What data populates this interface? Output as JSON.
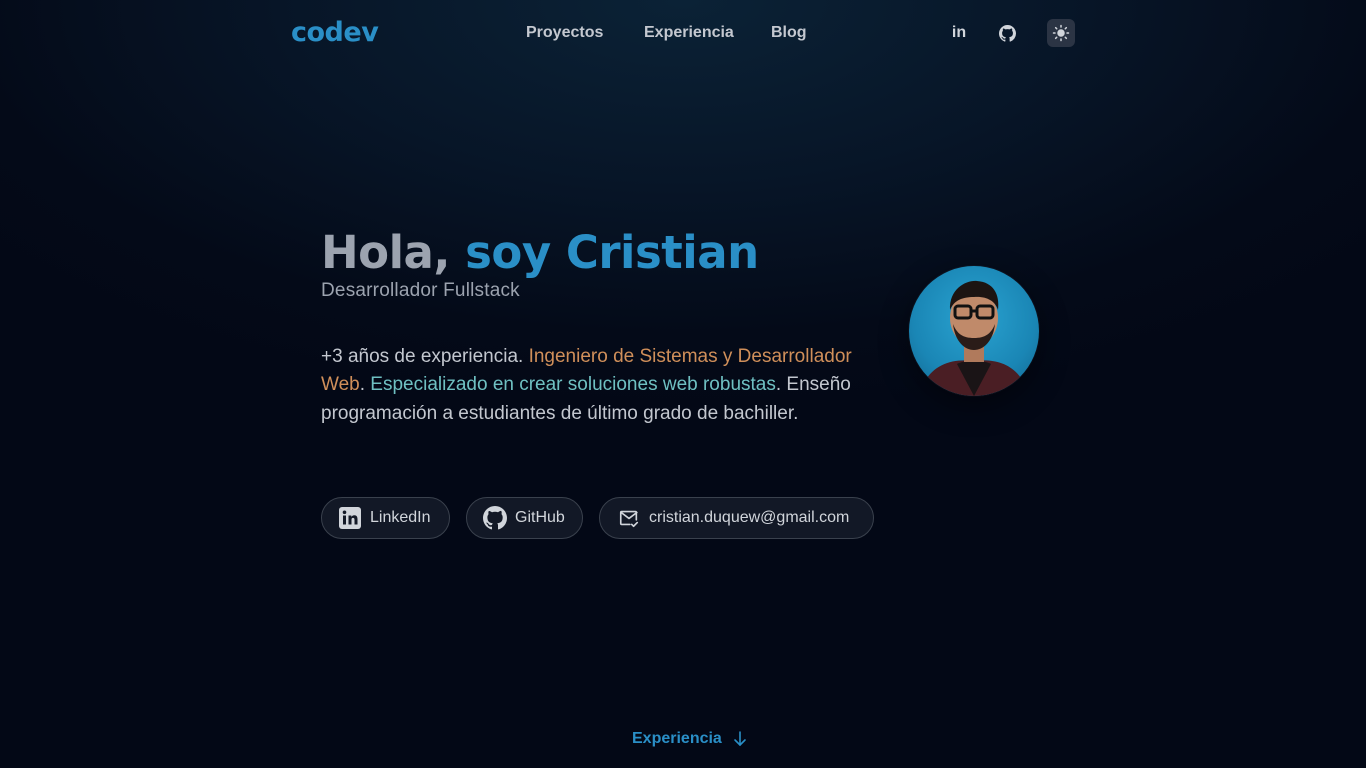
{
  "header": {
    "logo": "codev",
    "nav": [
      {
        "label": "Proyectos"
      },
      {
        "label": "Experiencia"
      },
      {
        "label": "Blog"
      }
    ],
    "social_icons": [
      "linkedin-icon",
      "github-icon"
    ],
    "linkedin_glyph": "in",
    "theme_icon": "sun-icon"
  },
  "hero": {
    "greeting": "Hola,",
    "name": "soy Cristian",
    "subtitle": "Desarrollador Fullstack",
    "bio": {
      "part1": "+3 años de experiencia. ",
      "part2": "Ingeniero de Sistemas y Desarrollador Web",
      "part3": ". ",
      "part4": "Especializado en crear soluciones web robustas",
      "part5": ". Enseño programación a estudiantes de último grado de bachiller."
    },
    "contacts": [
      {
        "label": "LinkedIn",
        "icon": "linkedin-icon"
      },
      {
        "label": "GitHub",
        "icon": "github-icon"
      },
      {
        "label": "cristian.duquew@gmail.com",
        "icon": "mail-icon"
      }
    ]
  },
  "scroll_cue": {
    "label": "Experiencia",
    "icon": "arrow-down-icon"
  },
  "colors": {
    "accent": "#2a8fc7",
    "orange_highlight": "#d08f5a",
    "teal_highlight": "#6fc0c2",
    "background": "#040a18"
  }
}
